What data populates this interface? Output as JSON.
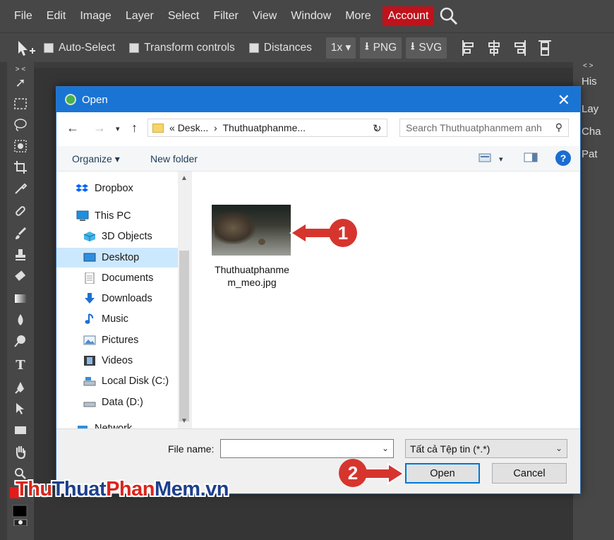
{
  "app": {
    "menu": [
      "File",
      "Edit",
      "Image",
      "Layer",
      "Select",
      "Filter",
      "View",
      "Window",
      "More"
    ],
    "account": "Account",
    "options": {
      "auto_select": "Auto-Select",
      "transform": "Transform controls",
      "distances": "Distances",
      "zoom": "1x",
      "png": "PNG",
      "svg": "SVG"
    },
    "left_collapse": "> <",
    "right_collapse": "< >",
    "right_panel": [
      "His",
      "Lay",
      "Cha",
      "Pat"
    ],
    "tool_T": "T"
  },
  "dialog": {
    "title": "Open",
    "breadcrumb_prefix": "«",
    "breadcrumb_1": "Desk...",
    "breadcrumb_sep": "›",
    "breadcrumb_2": "Thuthuatphanme...",
    "search_placeholder": "Search Thuthuatphanmem anh",
    "organize": "Organize ▾",
    "new_folder": "New folder",
    "help": "?",
    "nav": [
      {
        "label": "Dropbox"
      },
      {
        "label": "This PC"
      },
      {
        "label": "3D Objects"
      },
      {
        "label": "Desktop"
      },
      {
        "label": "Documents"
      },
      {
        "label": "Downloads"
      },
      {
        "label": "Music"
      },
      {
        "label": "Pictures"
      },
      {
        "label": "Videos"
      },
      {
        "label": "Local Disk (C:)"
      },
      {
        "label": "Data (D:)"
      },
      {
        "label": "Network"
      }
    ],
    "file": {
      "name_line1": "Thuthuatphanme",
      "name_line2": "m_meo.jpg"
    },
    "file_name_label": "File name:",
    "file_name_value": "",
    "file_type": "Tất cả Tệp tin (*.*)",
    "open_label": "Open",
    "cancel_label": "Cancel"
  },
  "annotations": {
    "callout_1": "1",
    "callout_2": "2"
  },
  "watermark": {
    "part1": "Thu",
    "part2": "Thuat",
    "part3": "Phan",
    "part4": "Mem",
    "part5": ".vn"
  },
  "colors": {
    "accent": "#1a74d4",
    "account": "#c0121b",
    "callout": "#d6352e",
    "selection": "#cce8ff"
  }
}
